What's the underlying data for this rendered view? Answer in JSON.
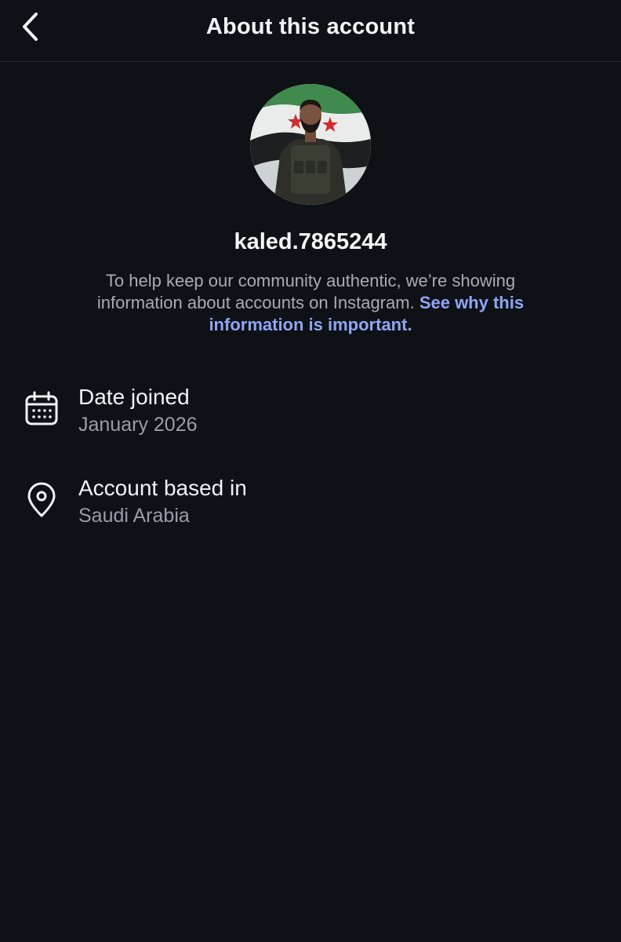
{
  "header": {
    "title": "About this account",
    "back_icon": "chevron-left-icon"
  },
  "profile": {
    "username": "kaled.7865244",
    "description_text": "To help keep our community authentic, we’re showing information about accounts on Instagram.",
    "description_link": "See why this information is important."
  },
  "details": [
    {
      "icon": "calendar-icon",
      "label": "Date joined",
      "value": "January 2026"
    },
    {
      "icon": "location-pin-icon",
      "label": "Account based in",
      "value": "Saudi Arabia"
    }
  ],
  "colors": {
    "background": "#0e1116",
    "link": "#8fa6f5",
    "secondary_text": "#9a9ea6"
  }
}
